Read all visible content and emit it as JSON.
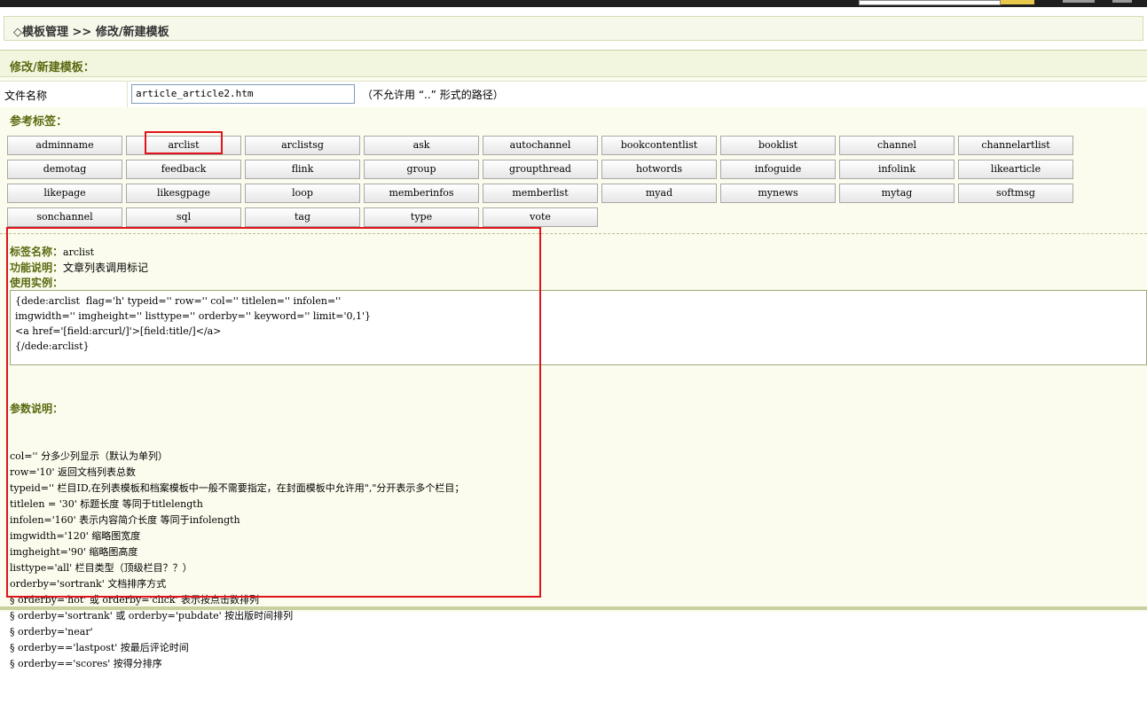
{
  "breadcrumb": "◇模板管理 >> 修改/新建模板",
  "section_title": "修改/新建模板：",
  "file": {
    "label": "文件名称",
    "value": "article_article2.htm",
    "hint": "（不允许用 “..” 形式的路径）"
  },
  "ref_title": "参考标签：",
  "tags": [
    "adminname",
    "arclist",
    "arclistsg",
    "ask",
    "autochannel",
    "bookcontentlist",
    "booklist",
    "channel",
    "channelartlist",
    "demotag",
    "feedback",
    "flink",
    "group",
    "groupthread",
    "hotwords",
    "infoguide",
    "infolink",
    "likearticle",
    "likepage",
    "likesgpage",
    "loop",
    "memberinfos",
    "memberlist",
    "myad",
    "mynews",
    "mytag",
    "softmsg",
    "sonchannel",
    "sql",
    "tag",
    "type",
    "vote"
  ],
  "selected_tag": "arclist",
  "info": {
    "name_label": "标签名称：",
    "name_value": "arclist",
    "func_label": "功能说明：",
    "func_value": "文章列表调用标记",
    "example_label": "使用实例："
  },
  "example_code": "{dede:arclist  flag='h' typeid='' row='' col='' titlelen='' infolen=''\nimgwidth='' imgheight='' listtype='' orderby='' keyword='' limit='0,1'}\n<a href='[field:arcurl/]'>[field:title/]</a>\n{/dede:arclist}",
  "params_title": "参数说明：",
  "params": [
    "col='' 分多少列显示（默认为单列）",
    "row='10' 返回文档列表总数",
    "typeid='' 栏目ID,在列表模板和档案模板中一般不需要指定，在封面模板中允许用\",\"分开表示多个栏目；",
    "titlelen = '30' 标题长度 等同于titlelength",
    "infolen='160' 表示内容简介长度 等同于infolength",
    "imgwidth='120' 缩略图宽度",
    "imgheight='90' 缩略图高度",
    "listtype='all' 栏目类型（顶级栏目？？）",
    "orderby='sortrank' 文档排序方式",
    "§ orderby='hot' 或 orderby='click' 表示按点击数排列",
    "§ orderby='sortrank' 或 orderby='pubdate' 按出版时间排列",
    "§ orderby='near'",
    "§ orderby=='lastpost' 按最后评论时间",
    "§ orderby=='scores' 按得分排序"
  ]
}
